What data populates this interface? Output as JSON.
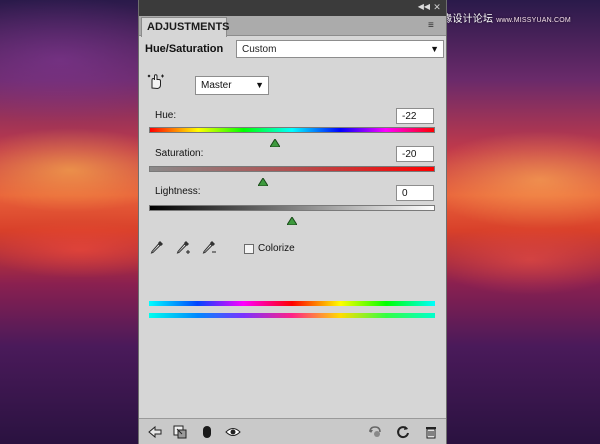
{
  "panel": {
    "tab_label": "ADJUSTMENTS",
    "adjustment_title": "Hue/Saturation",
    "preset": {
      "selected": "Custom"
    },
    "channel": {
      "selected": "Master"
    },
    "controls": {
      "hue": {
        "label": "Hue:",
        "value": "-22",
        "min": -180,
        "max": 180,
        "numeric": -22
      },
      "saturation": {
        "label": "Saturation:",
        "value": "-20",
        "min": -100,
        "max": 100,
        "numeric": -20
      },
      "lightness": {
        "label": "Lightness:",
        "value": "0",
        "min": -100,
        "max": 100,
        "numeric": 0
      }
    },
    "colorize": {
      "label": "Colorize",
      "checked": false
    },
    "icons": {
      "hand_tool": "targeted-adjustment-hand-icon",
      "eyedropper": "eyedropper-icon",
      "eyedropper_plus": "eyedropper-add-icon",
      "eyedropper_minus": "eyedropper-subtract-icon",
      "back": "back-arrow-icon",
      "clip": "clip-to-layer-icon",
      "mask": "layer-mask-icon",
      "visibility": "eye-icon",
      "view_previous": "view-previous-icon",
      "reset": "reset-icon",
      "delete": "trash-icon"
    }
  },
  "watermark": {
    "brand": "思缘设计论坛",
    "url": "www.MISSYUAN.COM"
  },
  "colors": {
    "panel_bg": "#d6d6d6",
    "topbar_bg": "#3b3b3b",
    "thumb_green": "#2f8f2f"
  }
}
